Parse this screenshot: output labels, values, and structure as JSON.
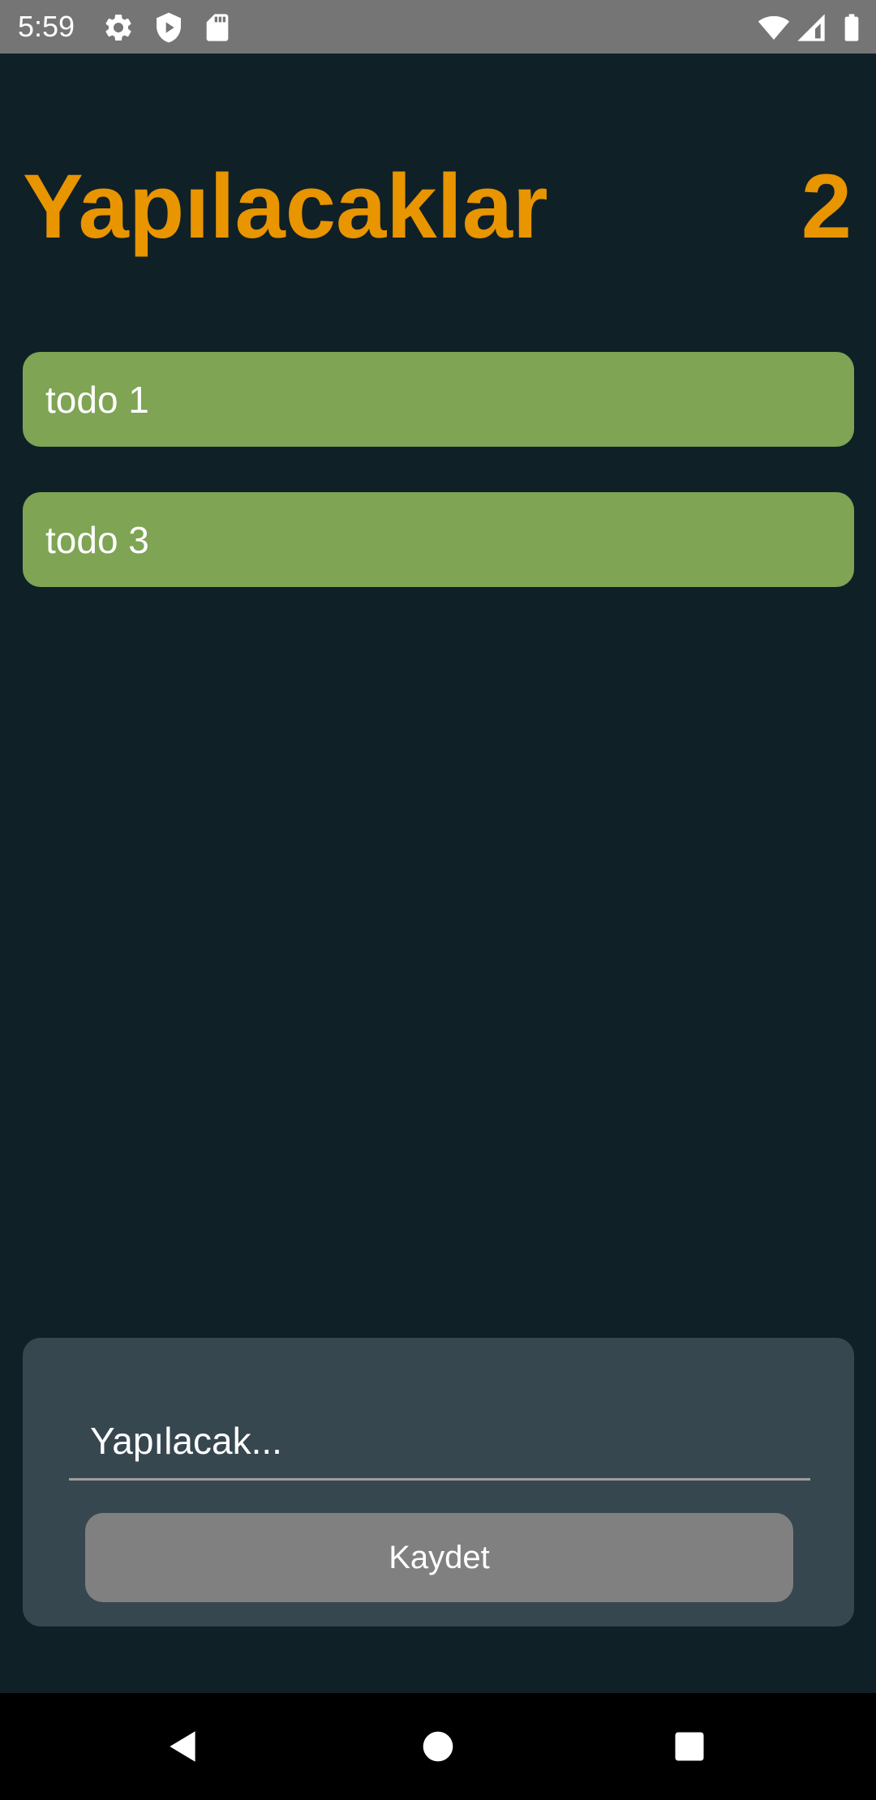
{
  "colors": {
    "background": "#102027",
    "accent": "#E89500",
    "todo_item": "#7EA454",
    "card": "#37474F",
    "button": "#808080",
    "status_bar": "#757575"
  },
  "status_bar": {
    "time": "5:59",
    "icons": [
      "gear-icon",
      "shield-play-icon",
      "sd-card-icon",
      "wifi-icon",
      "signal-icon",
      "battery-icon"
    ]
  },
  "header": {
    "title": "Yapılacaklar",
    "count": "2"
  },
  "todos": [
    {
      "text": "todo 1"
    },
    {
      "text": "todo 3"
    }
  ],
  "form": {
    "input_placeholder": "Yapılacak...",
    "input_value": "",
    "save_label": "Kaydet"
  },
  "nav_bar": {
    "icons": [
      "back-icon",
      "home-icon",
      "recents-icon"
    ]
  }
}
